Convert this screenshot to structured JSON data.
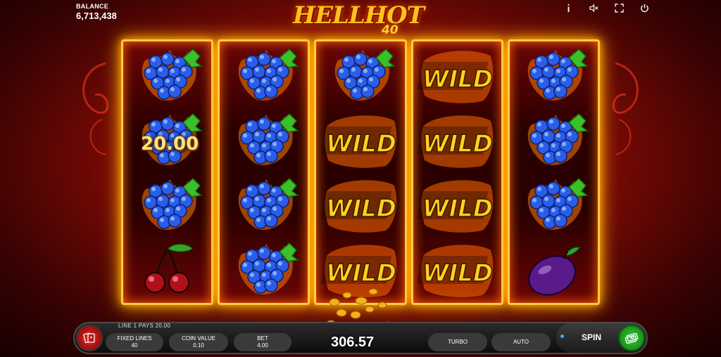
{
  "header": {
    "balance_label": "BALANCE",
    "balance_value": "6,713,438"
  },
  "logo": {
    "title": "HELLHOT",
    "number": "40"
  },
  "top_icons": [
    "info-icon",
    "sound-mute-icon",
    "fullscreen-icon",
    "power-icon"
  ],
  "reels": [
    [
      "grapes",
      "grapes",
      "grapes",
      "cherry"
    ],
    [
      "grapes",
      "grapes",
      "grapes",
      "grapes"
    ],
    [
      "grapes",
      "wild",
      "wild",
      "wild"
    ],
    [
      "wild",
      "wild",
      "wild",
      "wild"
    ],
    [
      "grapes",
      "grapes",
      "grapes",
      "plum"
    ]
  ],
  "wild_text": "WILD",
  "win_label": "20.00",
  "bottom": {
    "line_pays": "LINE 1 PAYS 20.00",
    "fixed_lines_label": "FIXED LINES",
    "fixed_lines_value": "40",
    "coin_value_label": "COIN VALUE",
    "coin_value_value": "0.10",
    "bet_label": "BET",
    "bet_value": "4.00",
    "win_amount": "306.57",
    "turbo_label": "TURBO",
    "auto_label": "AUTO",
    "spin_label": "SPIN"
  },
  "colors": {
    "background": "#8a0c05",
    "reel_frame": "#ffcc44",
    "wild_text": "#ffd21a",
    "grape": "#2a5ee8",
    "spin_green": "#2fb52f",
    "paytable_red": "#d42424"
  }
}
